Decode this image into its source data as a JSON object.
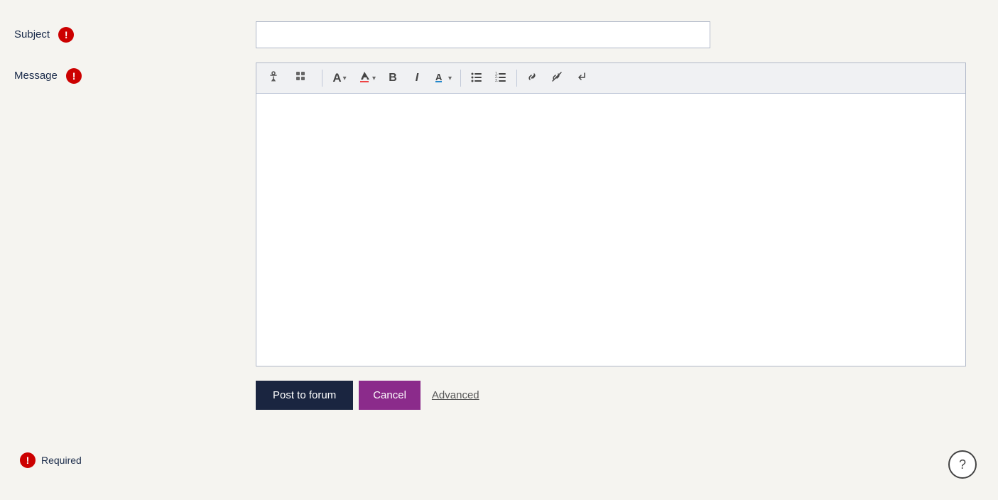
{
  "form": {
    "subject_label": "Subject",
    "message_label": "Message",
    "required_label": "Required"
  },
  "toolbar": {
    "accessibility_icon": "♿",
    "grid_icon": "⊞",
    "font_size_label": "A",
    "color_label": "●",
    "bold_label": "B",
    "italic_label": "I",
    "highlight_label": "A",
    "bullet_list_icon": "☰",
    "numbered_list_icon": "≡",
    "link_icon": "🔗",
    "unlink_icon": "✂",
    "special_char_icon": "↵"
  },
  "buttons": {
    "post_label": "Post to forum",
    "cancel_label": "Cancel",
    "advanced_label": "Advanced"
  },
  "help": {
    "icon": "?"
  }
}
